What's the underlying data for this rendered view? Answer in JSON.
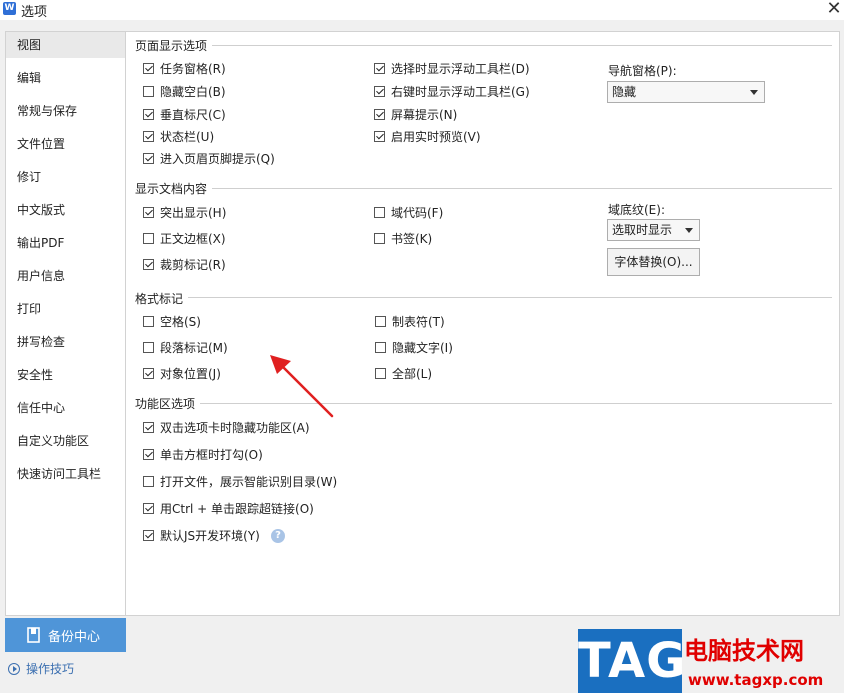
{
  "window": {
    "title": "选项",
    "app_icon": "wps-writer-icon"
  },
  "sidebar": {
    "items": [
      {
        "label": "视图",
        "active": true
      },
      {
        "label": "编辑"
      },
      {
        "label": "常规与保存"
      },
      {
        "label": "文件位置"
      },
      {
        "label": "修订"
      },
      {
        "label": "中文版式"
      },
      {
        "label": "输出PDF"
      },
      {
        "label": "用户信息"
      },
      {
        "label": "打印"
      },
      {
        "label": "拼写检查"
      },
      {
        "label": "安全性"
      },
      {
        "label": "信任中心"
      },
      {
        "label": "自定义功能区"
      },
      {
        "label": "快速访问工具栏"
      }
    ]
  },
  "sections": {
    "page_display": {
      "title": "页面显示选项",
      "options": [
        {
          "label": "任务窗格(R)",
          "checked": true
        },
        {
          "label": "隐藏空白(B)",
          "checked": false
        },
        {
          "label": "垂直标尺(C)",
          "checked": true
        },
        {
          "label": "状态栏(U)",
          "checked": true
        },
        {
          "label": "进入页眉页脚提示(Q)",
          "checked": true
        },
        {
          "label": "选择时显示浮动工具栏(D)",
          "checked": true
        },
        {
          "label": "右键时显示浮动工具栏(G)",
          "checked": true
        },
        {
          "label": "屏幕提示(N)",
          "checked": true
        },
        {
          "label": "启用实时预览(V)",
          "checked": true
        }
      ],
      "nav_pane_label": "导航窗格(P):",
      "nav_pane_value": "隐藏"
    },
    "doc_content": {
      "title": "显示文档内容",
      "options": [
        {
          "label": "突出显示(H)",
          "checked": true
        },
        {
          "label": "正文边框(X)",
          "checked": false
        },
        {
          "label": "裁剪标记(R)",
          "checked": true
        },
        {
          "label": "域代码(F)",
          "checked": false
        },
        {
          "label": "书签(K)",
          "checked": false
        }
      ],
      "field_shading_label": "域底纹(E):",
      "field_shading_value": "选取时显示",
      "font_replace_button": "字体替换(O)..."
    },
    "format_marks": {
      "title": "格式标记",
      "options": [
        {
          "label": "空格(S)",
          "checked": false
        },
        {
          "label": "段落标记(M)",
          "checked": false
        },
        {
          "label": "对象位置(J)",
          "checked": true
        },
        {
          "label": "制表符(T)",
          "checked": false
        },
        {
          "label": "隐藏文字(I)",
          "checked": false
        },
        {
          "label": "全部(L)",
          "checked": false
        }
      ]
    },
    "ribbon": {
      "title": "功能区选项",
      "options": [
        {
          "label": "双击选项卡时隐藏功能区(A)",
          "checked": true
        },
        {
          "label": "单击方框时打勾(O)",
          "checked": true
        },
        {
          "label": "打开文件，展示智能识别目录(W)",
          "checked": false
        },
        {
          "label": "用Ctrl + 单击跟踪超链接(O)",
          "checked": true
        },
        {
          "label": "默认JS开发环境(Y)",
          "checked": true
        }
      ],
      "help_icon": "question-circle-icon",
      "help_glyph": "?"
    }
  },
  "footer": {
    "backup_label": "备份中心",
    "tips_label": "操作技巧"
  },
  "watermark": {
    "tag": "TAG",
    "name": "电脑技术网",
    "url": "www.tagxp.com"
  },
  "colors": {
    "accent": "#4f95d8",
    "annotation_arrow": "#e02020",
    "watermark_blue": "#1a6fc0",
    "watermark_red": "#e00000"
  }
}
